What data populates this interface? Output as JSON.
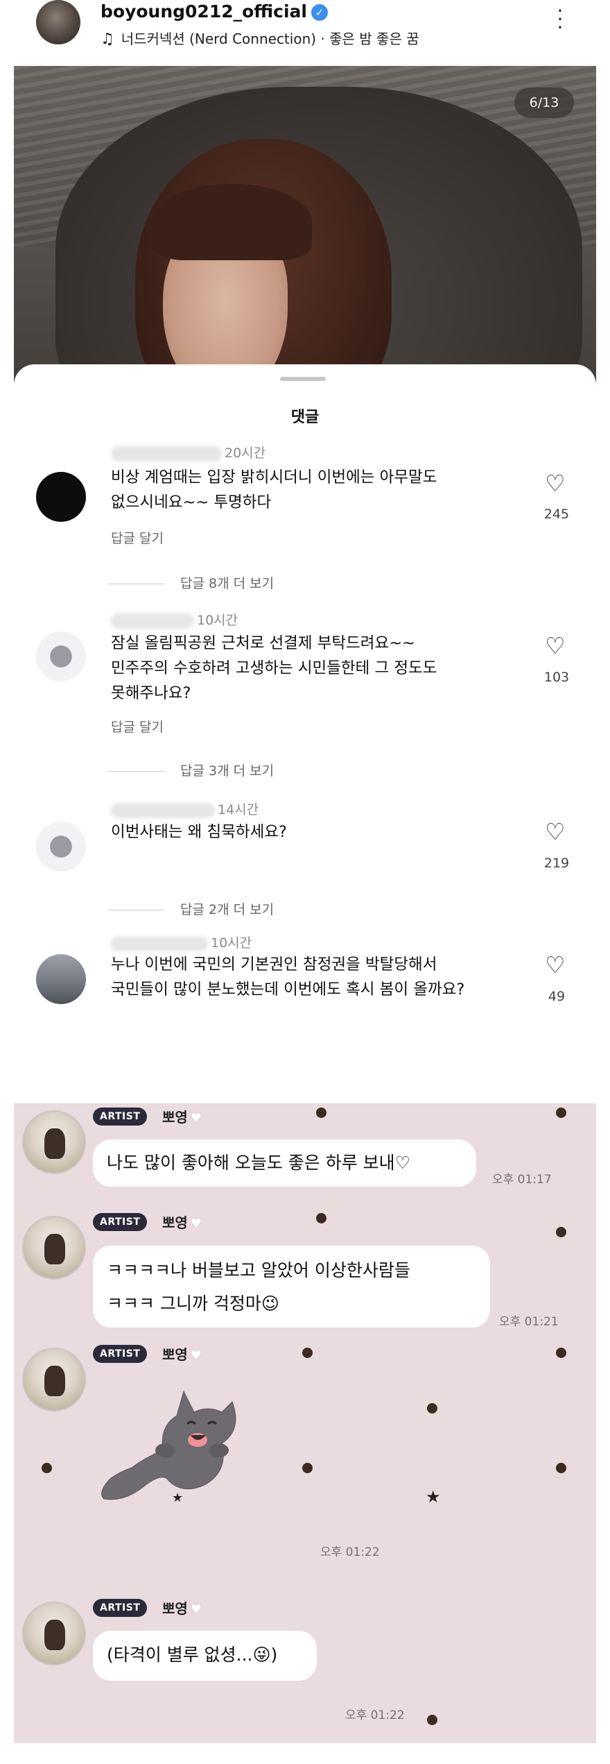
{
  "post": {
    "username": "boyoung0212_official",
    "verified_icon": "verified-badge-icon",
    "music_icon": "music-note-icon",
    "music_text": "너드커넥션 (Nerd Connection) · 좋은 밤 좋은 꿈",
    "more_icon": "more-vertical-icon",
    "image_counter": "6/13"
  },
  "comments_sheet": {
    "title": "댓글",
    "comments": [
      {
        "time": "20시간",
        "text_lines": [
          "비상 계엄때는 입장 밝히시더니 이번에는 아무말도",
          "없으시네요~~ 투명하다"
        ],
        "reply_label": "답글 달기",
        "likes": "245",
        "more_replies": "답글 8개 더 보기"
      },
      {
        "time": "10시간",
        "text_lines": [
          "잠실 올림픽공원 근처로 선결제 부탁드려요~~",
          "민주주의 수호하려 고생하는 시민들한테 그 정도도",
          "못해주나요?"
        ],
        "reply_label": "답글 달기",
        "likes": "103",
        "more_replies": "답글 3개 더 보기"
      },
      {
        "time": "14시간",
        "text_lines": [
          "이번사태는 왜 침묵하세요?"
        ],
        "likes": "219",
        "more_replies": "답글 2개 더 보기"
      },
      {
        "time": "10시간",
        "text_lines": [
          "누나 이번에 국민의 기본권인 참정권을 박탈당해서",
          "국민들이 많이 분노했는데 이번에도 혹시 봄이 올까요?"
        ],
        "likes": "49"
      }
    ],
    "heart_icon": "heart-outline-icon"
  },
  "chat": {
    "background_color": "#eadbdf",
    "messages": [
      {
        "badge": "ARTIST",
        "name": "뽀영",
        "name_icon": "white-heart-icon",
        "text_lines": [
          "나도 많이 좋아해 오늘도 좋은 하루 보내♡"
        ],
        "time": "오후 01:17"
      },
      {
        "badge": "ARTIST",
        "name": "뽀영",
        "text_lines": [
          "ㅋㅋㅋㅋ나 버블보고 알았어 이상한사람들",
          "ㅋㅋㅋ 그니까 걱정마😉"
        ],
        "time": "오후 01:21"
      },
      {
        "badge": "ARTIST",
        "name": "뽀영",
        "sticker": "gray-cat-sticker-icon",
        "time": "오후 01:22"
      },
      {
        "badge": "ARTIST",
        "name": "뽀영",
        "text_lines": [
          "(타격이 별루 없셩...😜)"
        ],
        "time": "오후 01:22"
      }
    ]
  }
}
